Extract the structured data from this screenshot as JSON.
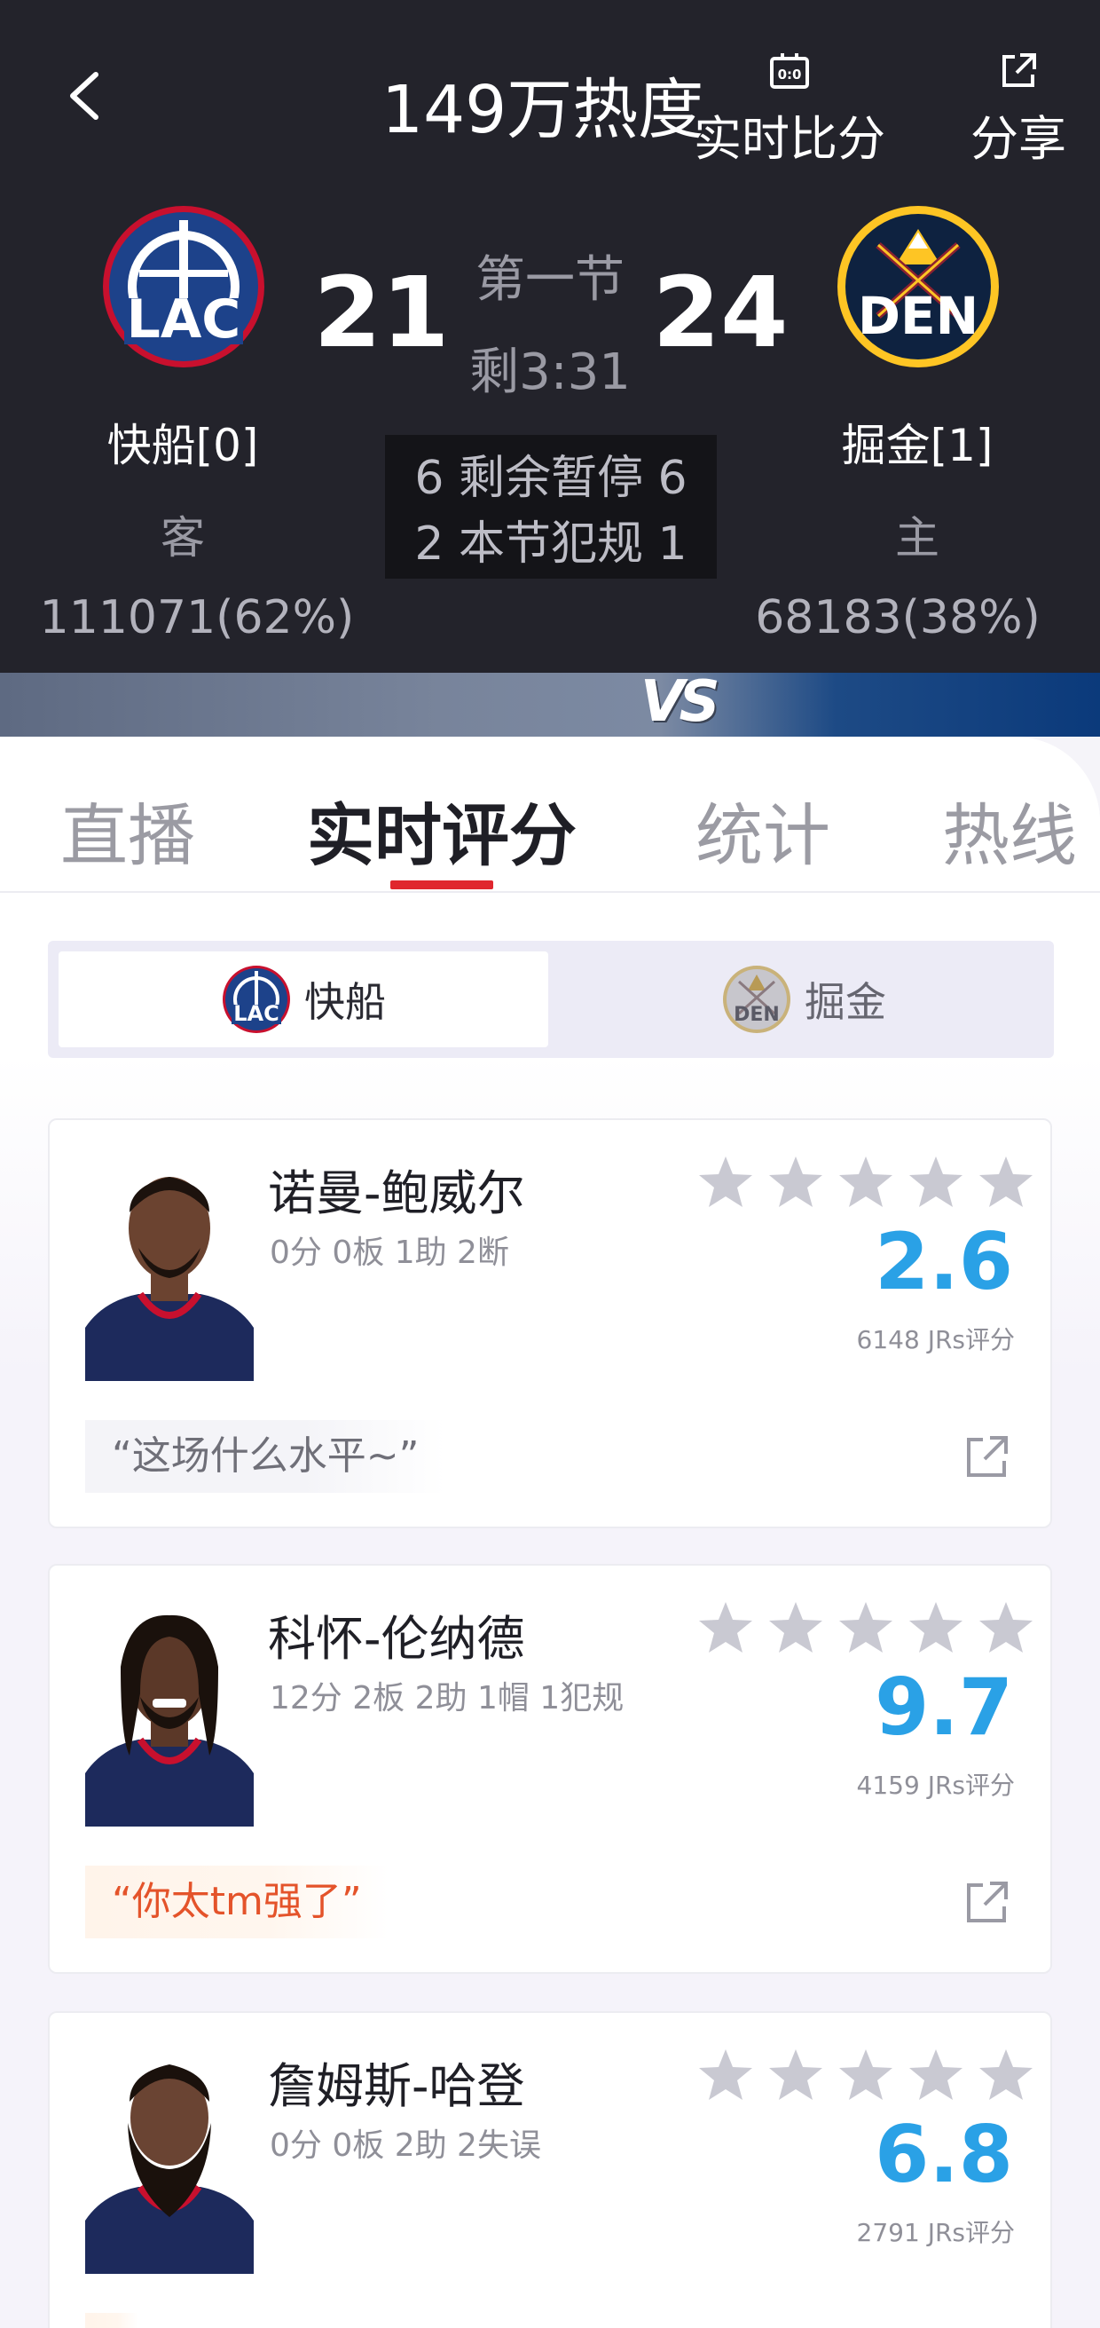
{
  "header": {
    "heat": "149万热度",
    "live_score_label": "实时比分",
    "share_label": "分享",
    "colors": {
      "background": "#23232b",
      "band_away": "#7c8aa3",
      "band_home": "#0b3a7b"
    }
  },
  "game": {
    "away": {
      "name": "快船[0]",
      "logo_text": "LAC",
      "role": "客",
      "score": "21",
      "votes": "111071(62%)"
    },
    "home": {
      "name": "掘金[1]",
      "logo_text": "DEN",
      "role": "主",
      "score": "24",
      "votes": "68183(38%)"
    },
    "period": "第一节",
    "time_left": "剩3:31",
    "timeouts_row": "6 剩余暂停 6",
    "fouls_row": "2 本节犯规 1",
    "vs_text": "VS"
  },
  "tabs": [
    {
      "label": "直播",
      "active": false
    },
    {
      "label": "实时评分",
      "active": true
    },
    {
      "label": "统计",
      "active": false
    },
    {
      "label": "热线",
      "active": false
    }
  ],
  "team_switch": [
    {
      "label": "快船",
      "logo_text": "LAC",
      "active": true
    },
    {
      "label": "掘金",
      "logo_text": "DEN",
      "active": false
    }
  ],
  "players": [
    {
      "name": "诺曼-鲍威尔",
      "stats": "0分 0板 1助 2断",
      "rating": "2.6",
      "rating_count": "6148 JRs评分",
      "comment": "“这场什么水平~”",
      "comment_style": "normal",
      "stars_filled": 0
    },
    {
      "name": "科怀-伦纳德",
      "stats": "12分 2板 2助 1帽 1犯规",
      "rating": "9.7",
      "rating_count": "4159 JRs评分",
      "comment": "“你太tm强了”",
      "comment_style": "hot",
      "stars_filled": 0
    },
    {
      "name": "詹姆斯-哈登",
      "stats": "0分 0板 2助 2失误",
      "rating": "6.8",
      "rating_count": "2791 JRs评分",
      "comment": "",
      "comment_style": "hot",
      "stars_filled": 0
    }
  ],
  "icons": {
    "back": "chevron-left-icon",
    "live_score": "scoreboard-icon",
    "share": "share-icon",
    "star": "star-icon",
    "card_share": "share-icon"
  },
  "accent_colors": {
    "rating": "#2aa1e6",
    "tab_underline": "#e0262e",
    "star": "#c9c9d2",
    "hot_comment": "#e4532a"
  }
}
